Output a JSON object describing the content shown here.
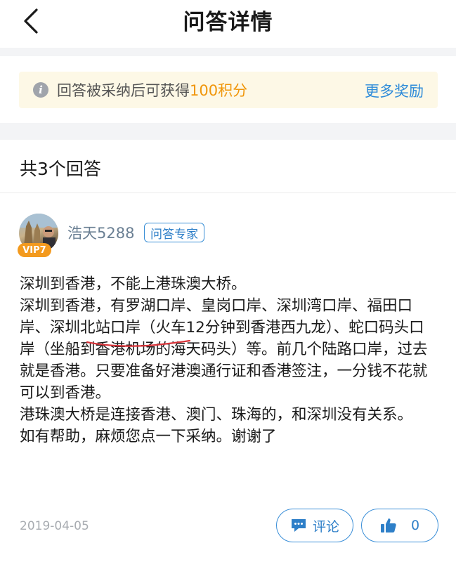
{
  "header": {
    "title": "问答详情"
  },
  "reward": {
    "text": "回答被采纳后可获得",
    "points": "100积分",
    "more_label": "更多奖励"
  },
  "answers_header": {
    "count_text": "共3个回答"
  },
  "answer": {
    "author": "浩天5288",
    "vip_badge": "VIP7",
    "expert_badge": "问答专家",
    "paragraphs": [
      "深圳到香港，不能上港珠澳大桥。",
      "深圳到香港，有罗湖口岸、皇岗口岸、深圳湾口岸、福田口岸、深圳北站口岸（火车12分钟到香港西九龙）、蛇口码头口岸（坐船到香港机场的海天码头）等。前几个陆路口岸，过去就是香港。只要准备好港澳通行证和香港签注，一分钱不花就可以到香港。",
      "港珠澳大桥是连接香港、澳门、珠海的，和深圳没有关系。",
      "如有帮助，麻烦您点一下采纳。谢谢了"
    ],
    "date": "2019-04-05",
    "comment_label": "评论",
    "like_count": "0"
  },
  "colors": {
    "accent": "#2e8bd9",
    "points": "#f0960a",
    "vip": "#f39a1e",
    "handwritten_underline": "#d9343a"
  }
}
